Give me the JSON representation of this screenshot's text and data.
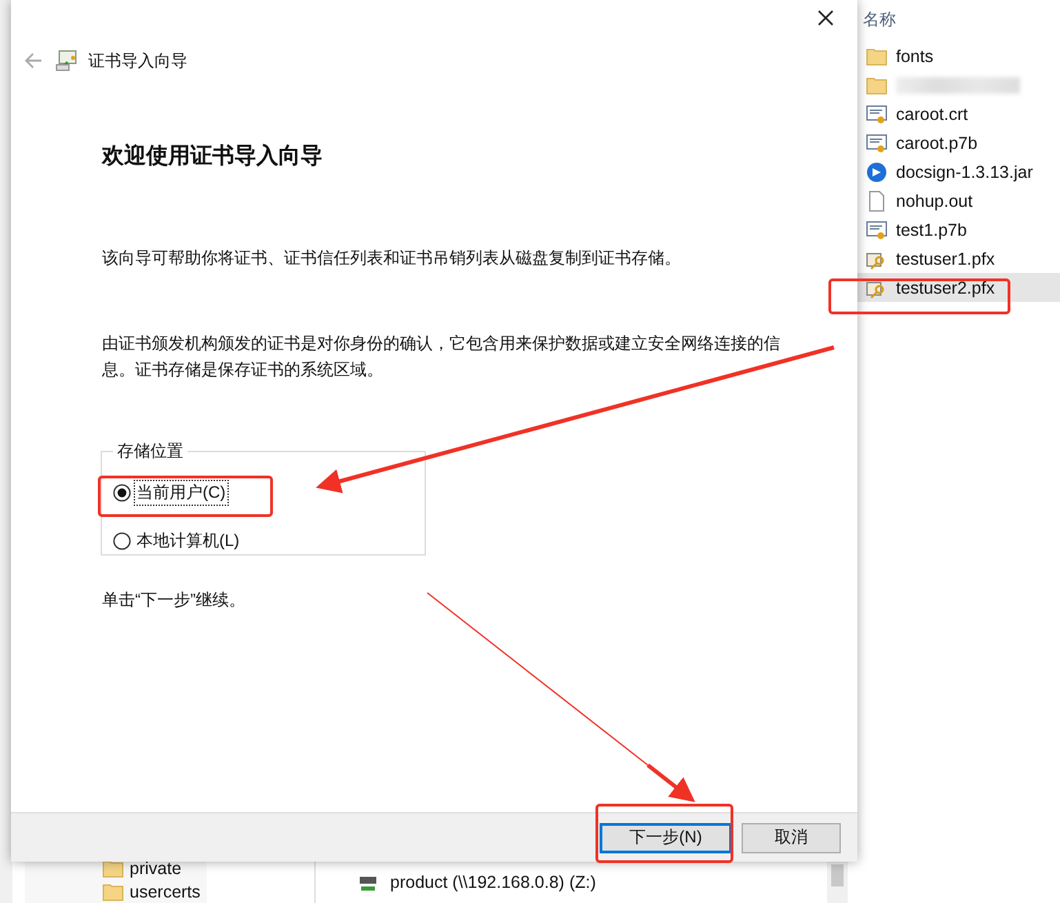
{
  "explorer": {
    "column_header": "名称",
    "files": [
      {
        "kind": "folder",
        "name": "fonts",
        "selected": false,
        "blurred": false
      },
      {
        "kind": "folder",
        "blurred": true,
        "selected": false
      },
      {
        "kind": "certificate",
        "name": "caroot.crt",
        "selected": false,
        "blurred": false
      },
      {
        "kind": "certificate",
        "name": "caroot.p7b",
        "selected": false,
        "blurred": false
      },
      {
        "kind": "jar",
        "name": "docsign-1.3.13.jar",
        "selected": false,
        "blurred": false
      },
      {
        "kind": "file",
        "name": "nohup.out",
        "selected": false,
        "blurred": false
      },
      {
        "kind": "certificate",
        "name": "test1.p7b",
        "selected": false,
        "blurred": false
      },
      {
        "kind": "pfx",
        "name": "testuser1.pfx",
        "selected": false,
        "blurred": false
      },
      {
        "kind": "pfx",
        "name": "testuser2.pfx",
        "selected": true,
        "blurred": false
      }
    ],
    "navigation_pane": [
      "private",
      "usercerts"
    ],
    "drive": "product (\\\\192.168.0.8) (Z:)"
  },
  "wizard": {
    "title": "证书导入向导",
    "heading": "欢迎使用证书导入向导",
    "intro": "该向导可帮助你将证书、证书信任列表和证书吊销列表从磁盘复制到证书存储。",
    "description": "由证书颁发机构颁发的证书是对你身份的确认，它包含用来保护数据或建立安全网络连接的信息。证书存储是保存证书的系统区域。",
    "store_location": {
      "legend": "存储位置",
      "options": [
        {
          "label": "当前用户(C)",
          "selected": true,
          "focused": true
        },
        {
          "label": "本地计算机(L)",
          "selected": false,
          "focused": false
        }
      ]
    },
    "hint": "单击“下一步”继续。",
    "buttons": [
      {
        "label": "下一步(N)",
        "default": true
      },
      {
        "label": "取消",
        "default": false
      }
    ]
  }
}
